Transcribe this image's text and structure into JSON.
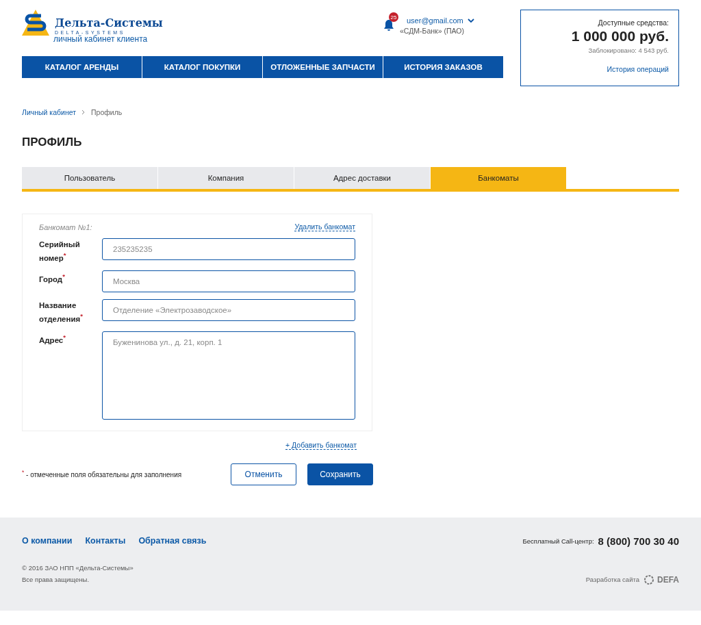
{
  "header": {
    "logo_name": "Дельта-Системы",
    "logo_sub": "DELTA-SYSTEMS",
    "logo_caption": "личный кабинет клиента",
    "notifications": "25",
    "user_email": "user@gmail.com",
    "user_company": "«СДМ-Банк» (ПАО)"
  },
  "nav": [
    "КАТАЛОГ АРЕНДЫ",
    "КАТАЛОГ ПОКУПКИ",
    "ОТЛОЖЕННЫЕ ЗАПЧАСТИ",
    "ИСТОРИЯ ЗАКАЗОВ"
  ],
  "balance": {
    "label": "Доступные средства:",
    "amount": "1 000 000 руб.",
    "blocked": "Заблокировано: 4 543 руб.",
    "history_link": "История операций"
  },
  "breadcrumbs": [
    {
      "label": "Личный кабинет",
      "link": true
    },
    {
      "label": "Профиль",
      "link": false
    }
  ],
  "page_title": "ПРОФИЛЬ",
  "tabs": [
    {
      "label": "Пользователь",
      "selected": false
    },
    {
      "label": "Компания",
      "selected": false
    },
    {
      "label": "Адрес доставки",
      "selected": false
    },
    {
      "label": "Банкоматы",
      "selected": true
    }
  ],
  "atm": {
    "title": "Банкомат №1:",
    "delete_link": "Удалить банкомат",
    "fields": [
      {
        "label": "Серийный номер",
        "required": true,
        "kind": "input",
        "placeholder": "235235235"
      },
      {
        "label": "Город",
        "required": true,
        "kind": "input",
        "placeholder": "Москва"
      },
      {
        "label": "Название отделения",
        "required": true,
        "kind": "input",
        "placeholder": "Отделение «Электрозаводское»"
      },
      {
        "label": "Адрес",
        "required": true,
        "kind": "textarea",
        "placeholder": "Буженинова ул., д. 21, корп. 1"
      }
    ]
  },
  "add_link": "+ Добавить банкомат",
  "required_mark": "*",
  "required_note": "- отмеченные поля обязательны для заполнения",
  "buttons": [
    {
      "label": "Отменить",
      "kind": "secondary"
    },
    {
      "label": "Сохранить",
      "kind": "primary"
    }
  ],
  "footer": {
    "links": [
      "О компании",
      "Контакты",
      "Обратная связь"
    ],
    "call_label": "Бесплатный Call-центр:",
    "phone": "8 (800) 700 30 40",
    "copyright": "© 2016 ЗАО НПП «Дельта-Системы»",
    "rights": "Все права защищены.",
    "dev_label": "Разработка сайта",
    "dev_name": "DEFA"
  }
}
